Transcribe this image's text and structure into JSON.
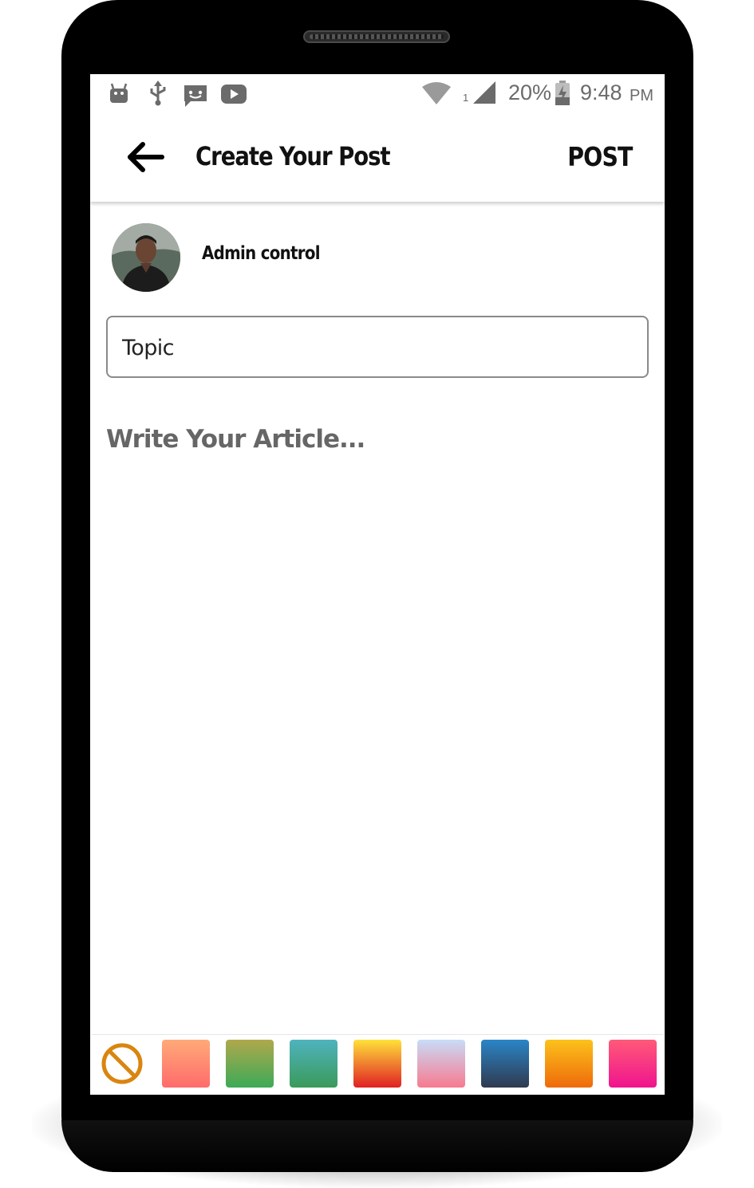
{
  "status_bar": {
    "icons": [
      "android-debug-icon",
      "usb-icon",
      "message-icon",
      "youtube-icon",
      "wifi-icon",
      "signal-icon",
      "battery-charging-icon"
    ],
    "sim_label": "1",
    "battery": "20%",
    "time": "9:48",
    "ampm": "PM"
  },
  "app_bar": {
    "back_icon": "arrow-left-icon",
    "title": "Create Your Post",
    "action_label": "POST"
  },
  "author": {
    "name": "Admin control",
    "avatar_icon": "user-photo"
  },
  "form": {
    "topic_placeholder": "Topic",
    "article_placeholder": "Write Your Article..."
  },
  "palette": {
    "none_icon": "no-color-icon",
    "none_color": "#d9850f",
    "colors": [
      {
        "top": "#ffaa78",
        "bottom": "#ff6b6b"
      },
      {
        "top": "#b0a84c",
        "bottom": "#3caa57"
      },
      {
        "top": "#4fb3be",
        "bottom": "#3a9a5a"
      },
      {
        "top": "#ffe13a",
        "bottom": "#e02024"
      },
      {
        "top": "#c8dcf8",
        "bottom": "#f77a8f"
      },
      {
        "top": "#2a85c7",
        "bottom": "#303a4f"
      },
      {
        "top": "#fcc21b",
        "bottom": "#ee6a0b"
      },
      {
        "top": "#ff5a78",
        "bottom": "#f0148e"
      }
    ]
  }
}
